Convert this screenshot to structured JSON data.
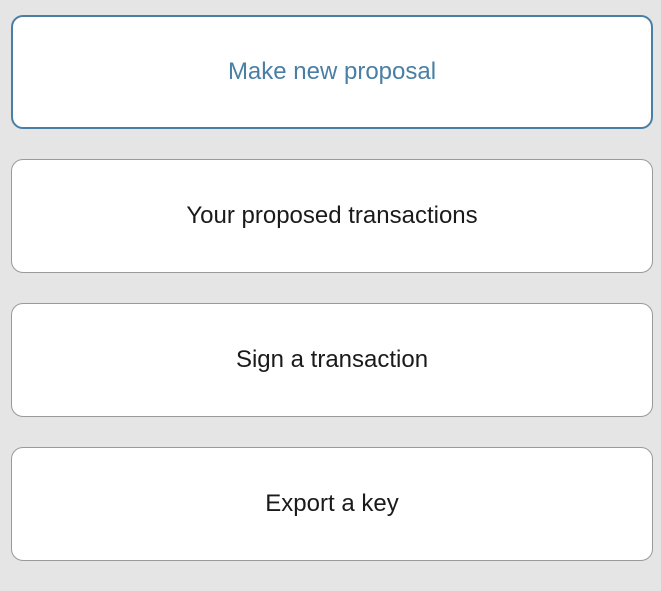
{
  "menu": {
    "items": [
      {
        "label": "Make new proposal"
      },
      {
        "label": "Your proposed transactions"
      },
      {
        "label": "Sign a transaction"
      },
      {
        "label": "Export a key"
      }
    ],
    "active_color": "#4a7fa5"
  }
}
